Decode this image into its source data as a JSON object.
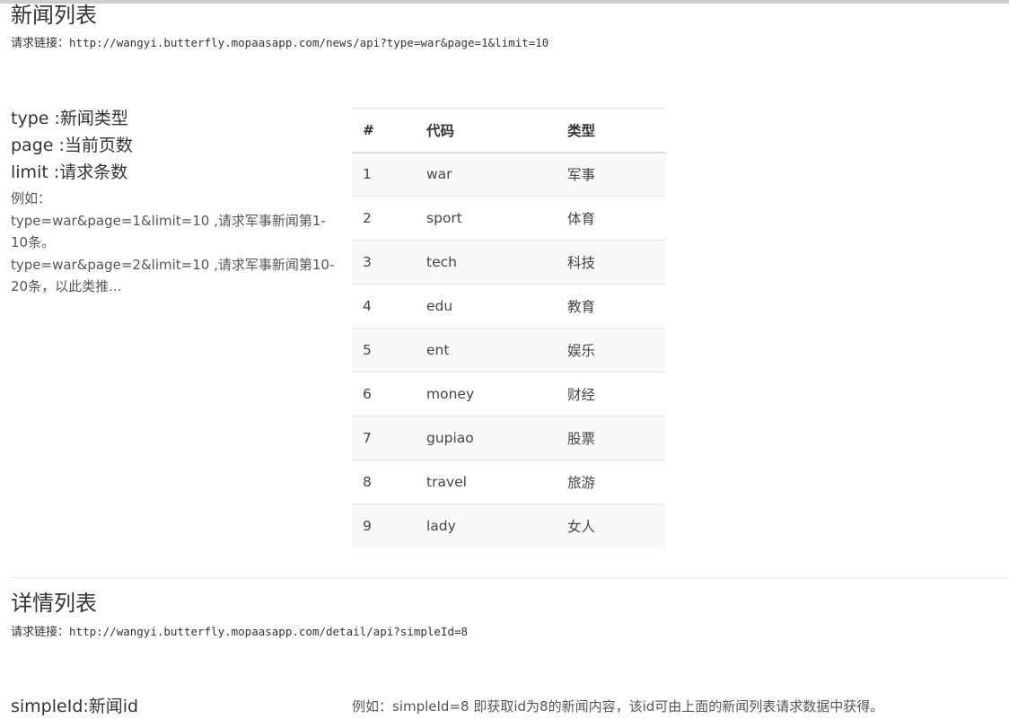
{
  "news_list": {
    "title": "新闻列表",
    "request_label": "请求链接：",
    "request_url": "http://wangyi.butterfly.mopaasapp.com/news/api?type=war&page=1&limit=10",
    "params": [
      "type :新闻类型",
      "page :当前页数",
      "limit :请求条数"
    ],
    "example_lines": [
      "例如：",
      "type=war&page=1&limit=10 ,请求军事新闻第1-10条。",
      "type=war&page=2&limit=10 ,请求军事新闻第10-20条，以此类推..."
    ],
    "table": {
      "headers": [
        "#",
        "代码",
        "类型"
      ],
      "rows": [
        [
          "1",
          "war",
          "军事"
        ],
        [
          "2",
          "sport",
          "体育"
        ],
        [
          "3",
          "tech",
          "科技"
        ],
        [
          "4",
          "edu",
          "教育"
        ],
        [
          "5",
          "ent",
          "娱乐"
        ],
        [
          "6",
          "money",
          "财经"
        ],
        [
          "7",
          "gupiao",
          "股票"
        ],
        [
          "8",
          "travel",
          "旅游"
        ],
        [
          "9",
          "lady",
          "女人"
        ]
      ]
    }
  },
  "detail_list": {
    "title": "详情列表",
    "request_label": "请求链接：",
    "request_url": "http://wangyi.butterfly.mopaasapp.com/detail/api?simpleId=8",
    "param": "simpleId:新闻id",
    "example": "例如：simpleId=8 即获取id为8的新闻内容，该id可由上面的新闻列表请求数据中获得。"
  }
}
